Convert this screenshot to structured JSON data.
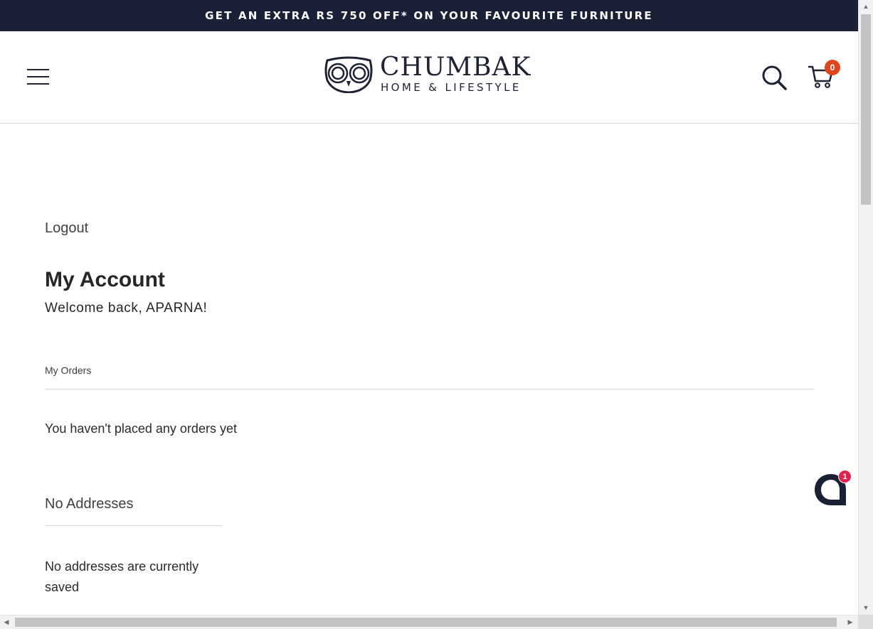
{
  "announcement": {
    "text": "GET AN EXTRA RS 750 OFF* ON YOUR FAVOURITE FURNITURE"
  },
  "header": {
    "brand_name": "CHUMBAK",
    "brand_tagline": "HOME & LIFESTYLE",
    "cart_count": "0",
    "icons": {
      "menu": "hamburger-menu-icon",
      "search": "search-icon",
      "cart": "cart-icon",
      "logo": "owl-logo-icon"
    }
  },
  "account": {
    "logout_label": "Logout",
    "title": "My Account",
    "welcome": "Welcome back, APARNA!",
    "orders": {
      "heading": "My Orders",
      "empty_message": "You haven't placed any orders yet"
    },
    "addresses": {
      "heading": "No Addresses",
      "empty_message": "No addresses are currently saved"
    }
  },
  "chat": {
    "badge_count": "1",
    "icon": "chat-bubble-icon"
  },
  "colors": {
    "announcement_bg": "#1a2035",
    "brand_navy": "#1f2233",
    "cart_badge": "#e0461c",
    "chat_badge": "#e0234e"
  }
}
